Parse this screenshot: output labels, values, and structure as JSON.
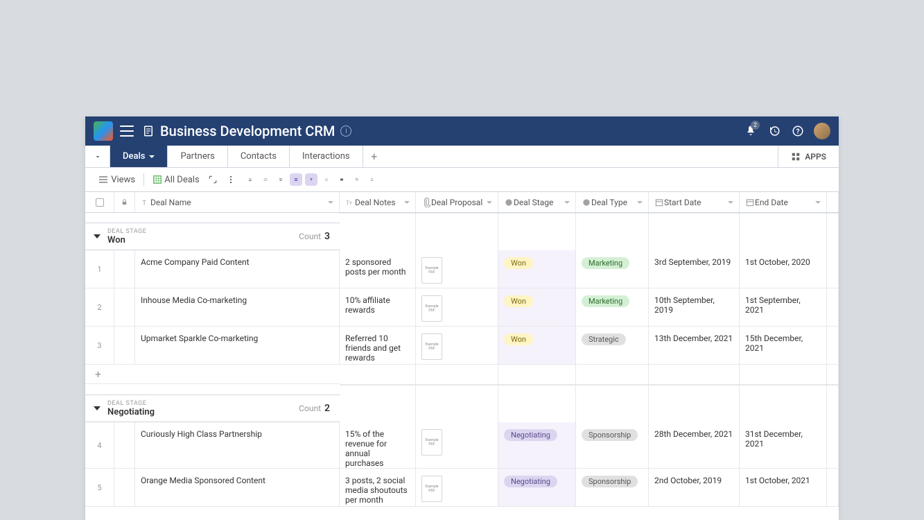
{
  "header": {
    "title": "Business Development CRM",
    "notif_count": "2"
  },
  "tabs": [
    "Deals",
    "Partners",
    "Contacts",
    "Interactions"
  ],
  "apps_label": "APPS",
  "toolbar": {
    "views": "Views",
    "all_deals": "All Deals"
  },
  "columns": [
    "Deal Name",
    "Deal Notes",
    "Deal Proposal",
    "Deal Stage",
    "Deal Type",
    "Start Date",
    "End Date"
  ],
  "group_meta": "DEAL STAGE",
  "count_label": "Count",
  "groups": [
    {
      "name": "Won",
      "count": "3",
      "rows": [
        {
          "n": "1",
          "name": "Acme Company Paid Content",
          "notes": "2 sponsored posts per month",
          "stage": "Won",
          "type": "Marketing",
          "sc": "marketing",
          "start": "3rd September, 2019",
          "end": "1st October, 2020"
        },
        {
          "n": "2",
          "name": "Inhouse Media Co-marketing",
          "notes": "10% affiliate rewards",
          "stage": "Won",
          "type": "Marketing",
          "sc": "marketing",
          "start": "10th September, 2019",
          "end": "1st September, 2021"
        },
        {
          "n": "3",
          "name": "Upmarket Sparkle Co-marketing",
          "notes": "Referred 10 friends and get rewards",
          "stage": "Won",
          "type": "Strategic",
          "sc": "strategic",
          "start": "13th December, 2021",
          "end": "15th December, 2021"
        }
      ]
    },
    {
      "name": "Negotiating",
      "count": "2",
      "rows": [
        {
          "n": "4",
          "name": "Curiously High Class Partnership",
          "notes": "15% of the revenue for annual purchases",
          "stage": "Negotiating",
          "type": "Sponsorship",
          "sc": "sponsorship",
          "start": "28th December, 2021",
          "end": "31st December, 2021"
        },
        {
          "n": "5",
          "name": "Orange Media Sponsored Content",
          "notes": "3 posts, 2 social media shoutouts per month",
          "stage": "Negotiating",
          "type": "Sponsorship",
          "sc": "sponsorship",
          "start": "2nd October, 2019",
          "end": "1st October, 2021"
        }
      ]
    }
  ]
}
